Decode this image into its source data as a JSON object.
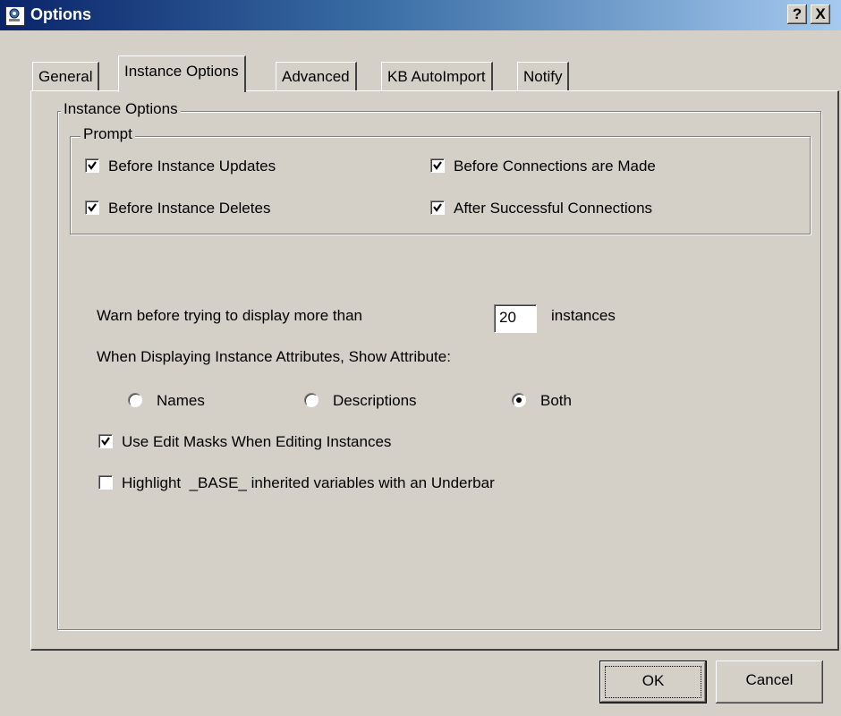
{
  "window": {
    "title": "Options",
    "help_button": "?",
    "close_button": "X"
  },
  "tabs": [
    {
      "label": "General",
      "active": false
    },
    {
      "label": "Instance Options",
      "active": true
    },
    {
      "label": "Advanced",
      "active": false
    },
    {
      "label": "KB AutoImport",
      "active": false
    },
    {
      "label": "Notify",
      "active": false
    }
  ],
  "instance_options": {
    "group_label": "Instance Options",
    "prompt": {
      "group_label": "Prompt",
      "items": [
        {
          "label": "Before Instance Updates",
          "checked": true
        },
        {
          "label": "Before Connections are Made",
          "checked": true
        },
        {
          "label": "Before Instance Deletes",
          "checked": true
        },
        {
          "label": "After Successful Connections",
          "checked": true
        }
      ]
    },
    "warn_label": "Warn before trying to display more than",
    "warn_value": "20",
    "warn_suffix": "instances",
    "attributes_label": "When Displaying Instance Attributes, Show Attribute:",
    "attribute_options": [
      {
        "label": "Names",
        "selected": false
      },
      {
        "label": "Descriptions",
        "selected": false
      },
      {
        "label": "Both",
        "selected": true
      }
    ],
    "edit_masks": {
      "label": "Use Edit Masks When Editing Instances",
      "checked": true
    },
    "highlight_base": {
      "label": "Highlight  _BASE_ inherited variables with an Underbar",
      "checked": false
    }
  },
  "buttons": {
    "ok": "OK",
    "cancel": "Cancel"
  }
}
